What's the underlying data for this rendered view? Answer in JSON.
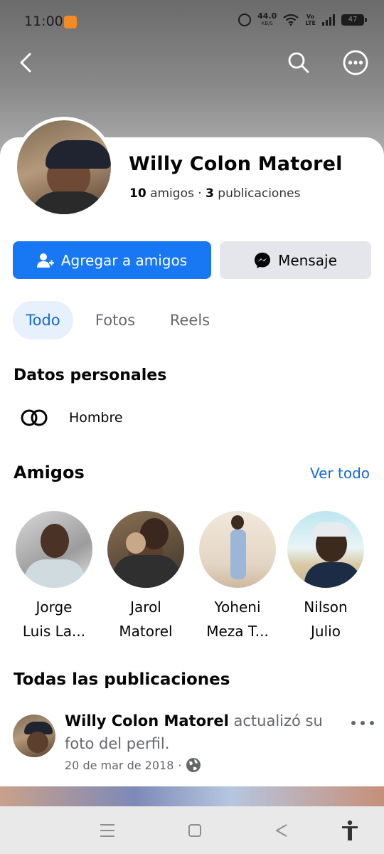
{
  "status_bar": {
    "time": "11:00",
    "speed_value": "44.0",
    "speed_unit": "KB/S",
    "volte_top": "Vo",
    "volte_bottom": "LTE",
    "battery": "47"
  },
  "profile": {
    "name": "Willy Colon Matorel",
    "friends_count": "10",
    "friends_label": "amigos",
    "separator": "·",
    "posts_count": "3",
    "posts_label": "publicaciones"
  },
  "actions": {
    "add_friend": "Agregar a amigos",
    "message": "Mensaje"
  },
  "tabs": [
    {
      "label": "Todo",
      "active": true
    },
    {
      "label": "Fotos"
    },
    {
      "label": "Reels"
    }
  ],
  "personal": {
    "title": "Datos personales",
    "gender": "Hombre"
  },
  "friends": {
    "title": "Amigos",
    "see_all": "Ver todo",
    "items": [
      {
        "line1": "Jorge",
        "line2": "Luis La..."
      },
      {
        "line1": "Jarol",
        "line2": "Matorel"
      },
      {
        "line1": "Yoheni",
        "line2": "Meza T..."
      },
      {
        "line1": "Nilson",
        "line2": "Julio"
      }
    ]
  },
  "posts": {
    "title": "Todas las publicaciones",
    "first": {
      "author": "Willy Colon Matorel",
      "action": " actualizó su foto del perfil.",
      "date": "20 de mar de 2018",
      "separator": "·"
    }
  },
  "colors": {
    "accent": "#1877f2",
    "link": "#1769d8",
    "tab_active_bg": "#e7f0fd",
    "secondary_button": "#e4e6eb"
  }
}
